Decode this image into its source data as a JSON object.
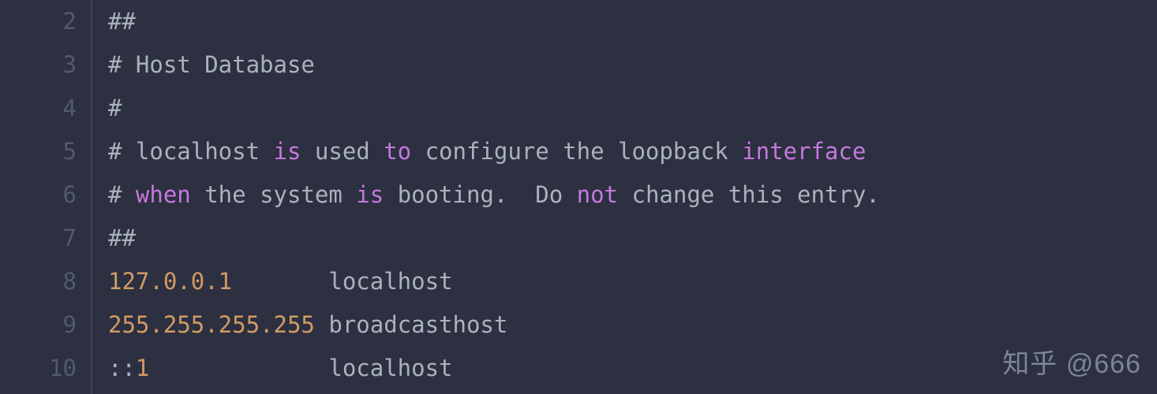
{
  "code": {
    "startLine": 2,
    "lines": [
      {
        "n": 2,
        "tokens": [
          [
            "c-default",
            "##"
          ]
        ]
      },
      {
        "n": 3,
        "tokens": [
          [
            "c-default",
            "# Host Database"
          ]
        ]
      },
      {
        "n": 4,
        "tokens": [
          [
            "c-default",
            "#"
          ]
        ]
      },
      {
        "n": 5,
        "tokens": [
          [
            "c-default",
            "# localhost "
          ],
          [
            "c-keyword",
            "is"
          ],
          [
            "c-default",
            " used "
          ],
          [
            "c-keyword",
            "to"
          ],
          [
            "c-default",
            " configure the loopback "
          ],
          [
            "c-keyword",
            "interface"
          ]
        ]
      },
      {
        "n": 6,
        "tokens": [
          [
            "c-default",
            "# "
          ],
          [
            "c-keyword",
            "when"
          ],
          [
            "c-default",
            " the system "
          ],
          [
            "c-keyword",
            "is"
          ],
          [
            "c-default",
            " booting.  Do "
          ],
          [
            "c-keyword",
            "not"
          ],
          [
            "c-default",
            " change this entry."
          ]
        ]
      },
      {
        "n": 7,
        "tokens": [
          [
            "c-default",
            "##"
          ]
        ]
      },
      {
        "n": 8,
        "tokens": [
          [
            "c-number",
            "127.0.0.1"
          ],
          [
            "c-default",
            "       localhost"
          ]
        ]
      },
      {
        "n": 9,
        "tokens": [
          [
            "c-number",
            "255.255.255.255"
          ],
          [
            "c-default",
            " broadcasthost"
          ]
        ]
      },
      {
        "n": 10,
        "tokens": [
          [
            "c-default",
            "::"
          ],
          [
            "c-number",
            "1"
          ],
          [
            "c-default",
            "             localhost"
          ]
        ]
      }
    ]
  },
  "watermark": "知乎 @666"
}
